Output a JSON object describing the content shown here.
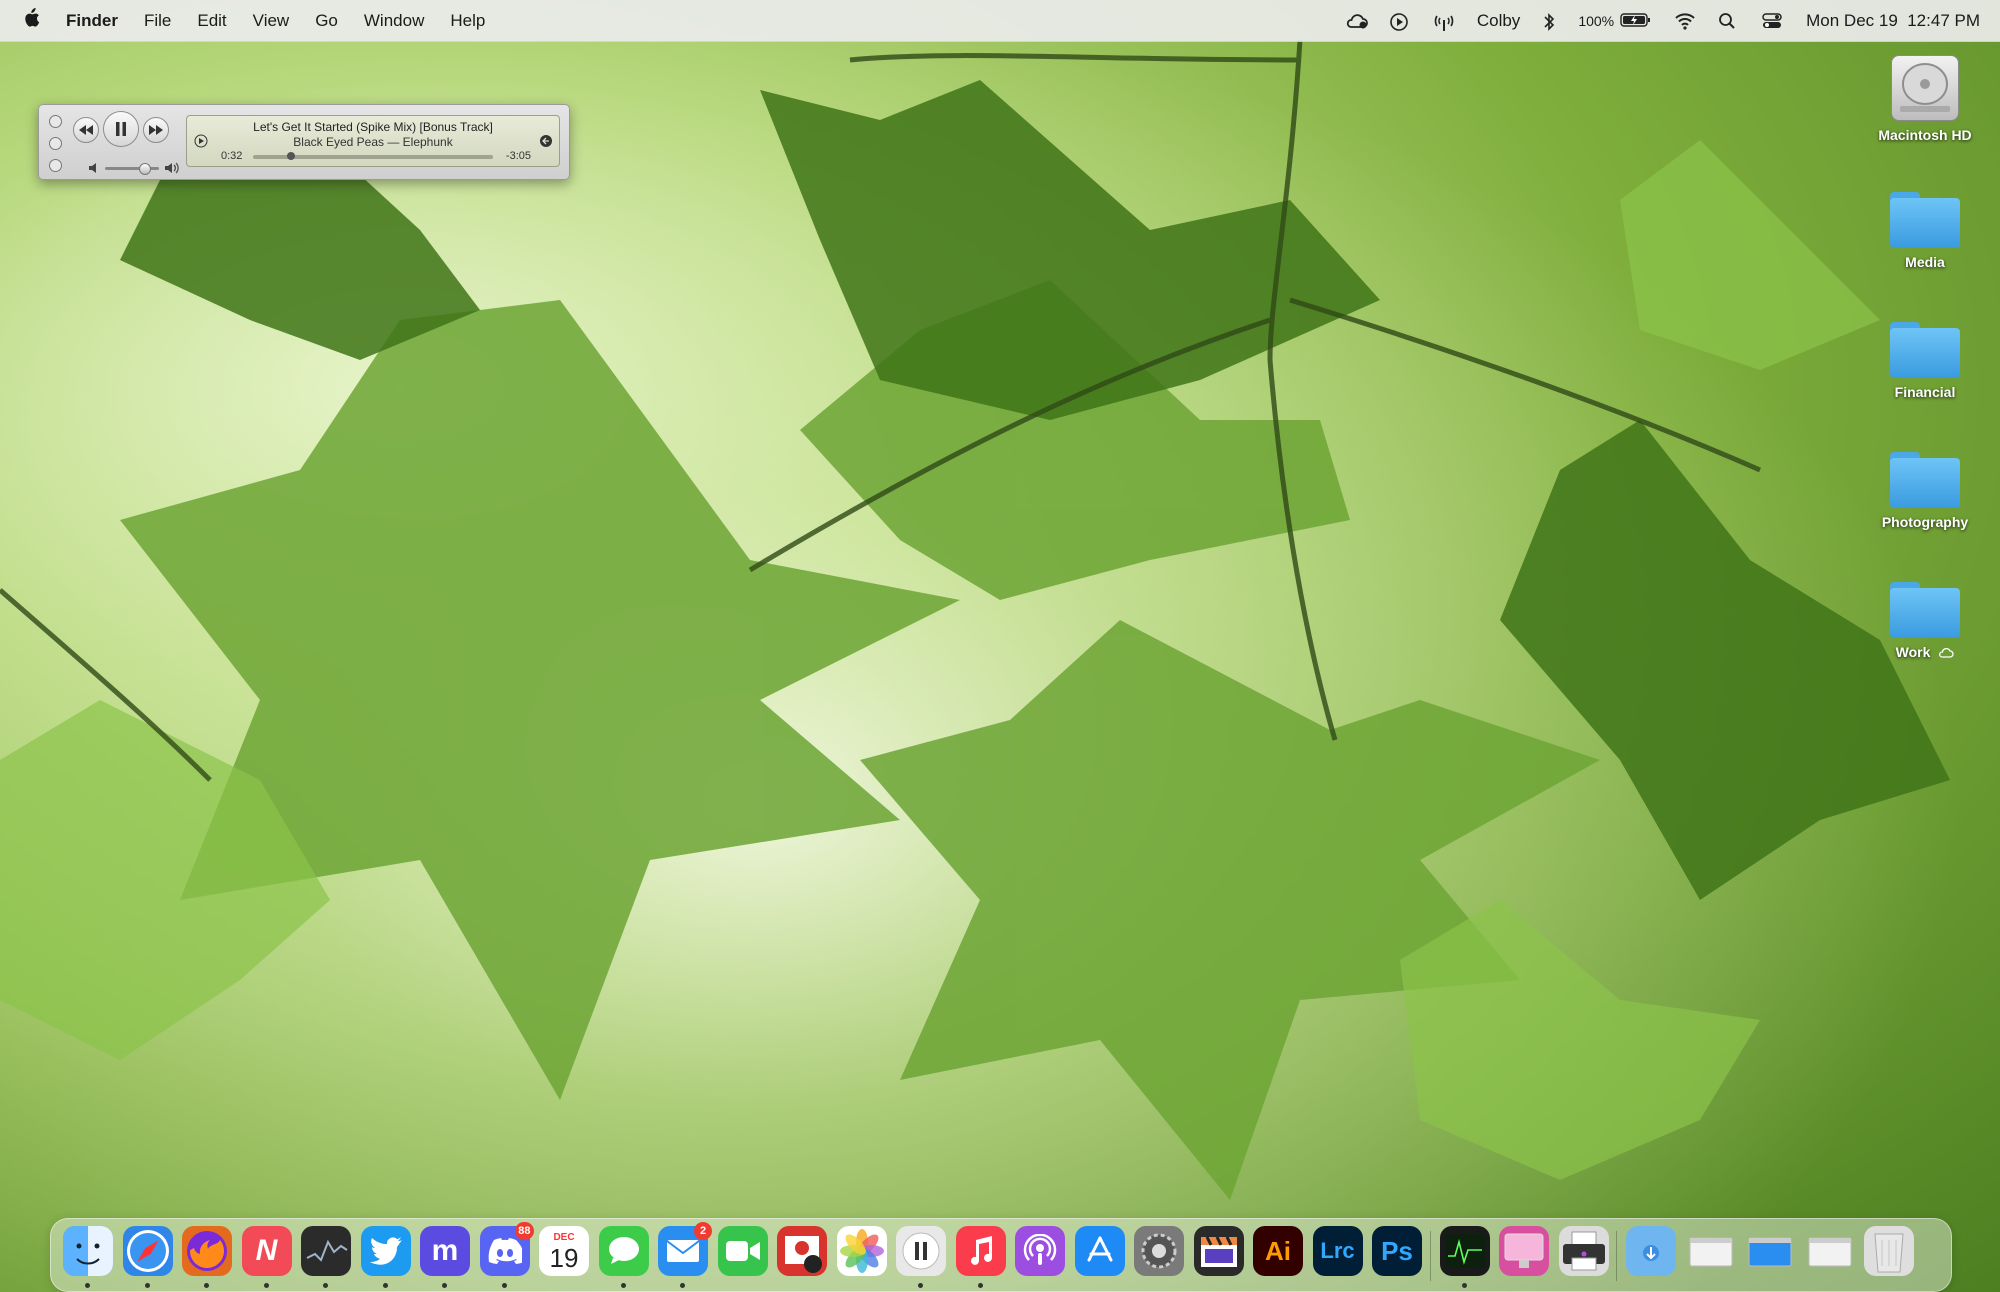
{
  "menubar": {
    "app_name": "Finder",
    "menus": [
      "File",
      "Edit",
      "View",
      "Go",
      "Window",
      "Help"
    ],
    "user": "Colby",
    "battery": "100%",
    "datetime": "Mon Dec 19  12:47 PM",
    "icons": [
      "apple-icon",
      "cloud-sync-icon",
      "play-circle-icon",
      "airdrop-antenna-icon",
      "bluetooth-icon",
      "battery-icon",
      "wifi-icon",
      "search-icon",
      "control-center-icon"
    ]
  },
  "player": {
    "track": "Let's Get It Started (Spike Mix) [Bonus Track]",
    "artist_album": "Black Eyed Peas — Elephunk",
    "elapsed": "0:32",
    "remaining": "-3:05",
    "progress": 0.148,
    "volume": 0.7
  },
  "desktop": {
    "items": [
      {
        "label": "Macintosh HD",
        "type": "drive"
      },
      {
        "label": "Media",
        "type": "folder"
      },
      {
        "label": "Financial",
        "type": "folder"
      },
      {
        "label": "Photography",
        "type": "folder"
      },
      {
        "label": "Work",
        "type": "folder"
      }
    ]
  },
  "dock": {
    "apps": [
      {
        "name": "finder",
        "icon": "finder-icon",
        "text": "",
        "color": "#3d8fe6",
        "running": true
      },
      {
        "name": "safari",
        "icon": "compass-icon",
        "text": "",
        "color": "#2f86e8",
        "running": true
      },
      {
        "name": "firefox",
        "icon": "firefox-icon",
        "text": "",
        "color": "#e46a1f",
        "running": true
      },
      {
        "name": "news",
        "icon": "news-icon",
        "text": "N",
        "color": "#f24a56",
        "running": true
      },
      {
        "name": "stocks",
        "icon": "stocks-icon",
        "text": "",
        "color": "#2b2b2b",
        "running": true
      },
      {
        "name": "twitter",
        "icon": "bird-icon",
        "text": "",
        "color": "#1d9bf0",
        "running": true
      },
      {
        "name": "mastodon",
        "icon": "mastodon-icon",
        "text": "m",
        "color": "#5b4be0",
        "running": true
      },
      {
        "name": "discord",
        "icon": "discord-icon",
        "text": "",
        "color": "#5865f2",
        "running": true,
        "badge": "88"
      },
      {
        "name": "calendar",
        "icon": "calendar-icon",
        "text": "19",
        "month": "DEC",
        "color": "#ffffff",
        "running": false
      },
      {
        "name": "messages",
        "icon": "message-bubble-icon",
        "text": "",
        "color": "#3ccc4a",
        "running": true
      },
      {
        "name": "mail",
        "icon": "envelope-icon",
        "text": "",
        "color": "#2a8ef0",
        "running": true,
        "badge": "2"
      },
      {
        "name": "facetime",
        "icon": "video-camera-icon",
        "text": "",
        "color": "#36c44c",
        "running": false
      },
      {
        "name": "photo-booth",
        "icon": "photo-booth-icon",
        "text": "",
        "color": "#d8332d",
        "running": false
      },
      {
        "name": "photos",
        "icon": "photos-icon",
        "text": "",
        "color": "#ffffff",
        "running": false
      },
      {
        "name": "now-playing",
        "icon": "pause-icon",
        "text": "",
        "color": "#e8e8e8",
        "running": true
      },
      {
        "name": "music",
        "icon": "music-note-icon",
        "text": "",
        "color": "#fa3c4c",
        "running": true
      },
      {
        "name": "podcasts",
        "icon": "podcast-icon",
        "text": "",
        "color": "#9b4ee0",
        "running": false
      },
      {
        "name": "app-store",
        "icon": "app-store-icon",
        "text": "",
        "color": "#1e8af5",
        "running": false
      },
      {
        "name": "system-preferences",
        "icon": "gear-icon",
        "text": "",
        "color": "#7a7a7a",
        "running": false
      },
      {
        "name": "final-cut",
        "icon": "clapper-icon",
        "text": "",
        "color": "#2a2a2a",
        "running": false
      },
      {
        "name": "illustrator",
        "icon": "illustrator-icon",
        "text": "Ai",
        "color": "#330000",
        "running": false
      },
      {
        "name": "lightroom-classic",
        "icon": "lightroom-icon",
        "text": "Lrc",
        "color": "#001e36",
        "running": false
      },
      {
        "name": "photoshop",
        "icon": "photoshop-icon",
        "text": "Ps",
        "color": "#001e36",
        "running": false
      }
    ],
    "extras": [
      {
        "name": "activity-monitor",
        "icon": "activity-monitor-icon",
        "color": "#1a1a1a",
        "running": true
      },
      {
        "name": "clean-my-mac",
        "icon": "imac-icon",
        "color": "#d84fa0",
        "running": false
      },
      {
        "name": "printer",
        "icon": "printer-icon",
        "color": "#dcdcdc",
        "running": false
      },
      {
        "name": "downloads-folder",
        "icon": "downloads-folder-icon",
        "color": "#6fb6f0",
        "running": false
      },
      {
        "name": "discord-window",
        "icon": "window-thumbnail-icon",
        "color": "#f2f2f2",
        "running": false
      },
      {
        "name": "twitter-window",
        "icon": "window-thumbnail-icon",
        "color": "#2a8ef0",
        "running": false
      },
      {
        "name": "safari-window",
        "icon": "window-thumbnail-icon",
        "color": "#f2f2f2",
        "running": false
      },
      {
        "name": "trash",
        "icon": "trash-icon",
        "color": "#dedede",
        "running": false
      }
    ]
  }
}
